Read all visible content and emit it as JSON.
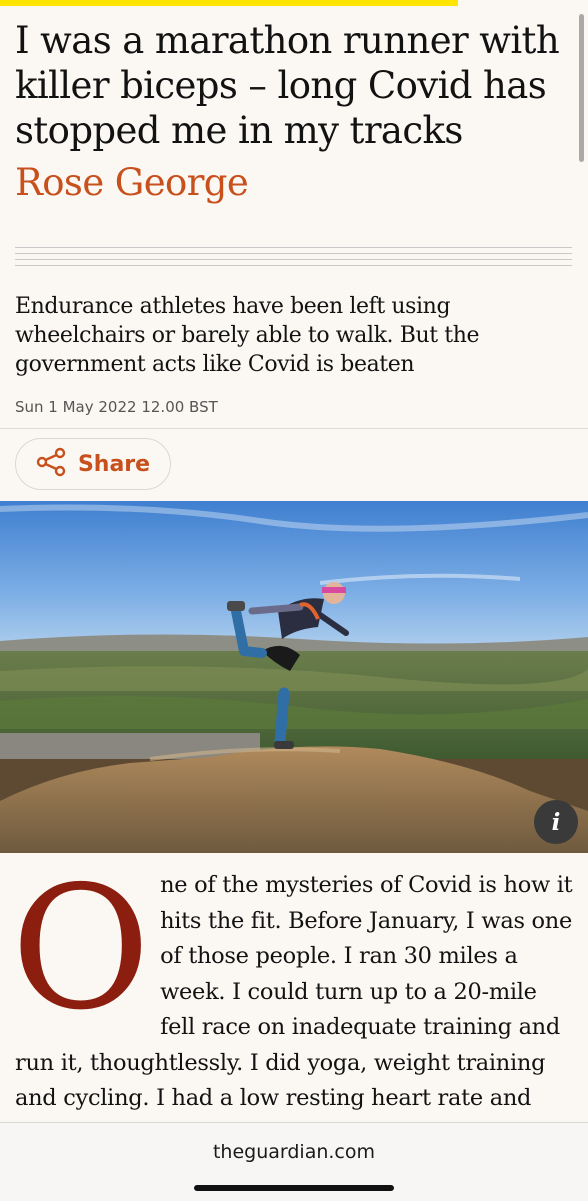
{
  "article": {
    "headline": "I was a marathon runner with killer biceps – long Covid has stopped me in my tracks",
    "byline": "Rose George",
    "standfirst": "Endurance athletes have been left using wheelchairs or barely able to walk. But the government acts like Covid is beaten",
    "dateline": "Sun 1 May 2022 12.00 BST",
    "share_label": "Share",
    "dropcap": "O",
    "body": "ne of the mysteries of Covid is how it hits the fit. Before January, I was one of those people. I ran 30 miles a week. I could turn up to a 20-mile fell race on inadequate training and run it, thoughtlessly. I did yoga, weight training and cycling. I had a low resting heart rate and"
  },
  "image": {
    "info_label": "i"
  },
  "browser": {
    "url": "theguardian.com"
  },
  "colors": {
    "accent": "#c7501d",
    "dropcap": "#8b1e0e",
    "topbar": "#ffe500"
  }
}
